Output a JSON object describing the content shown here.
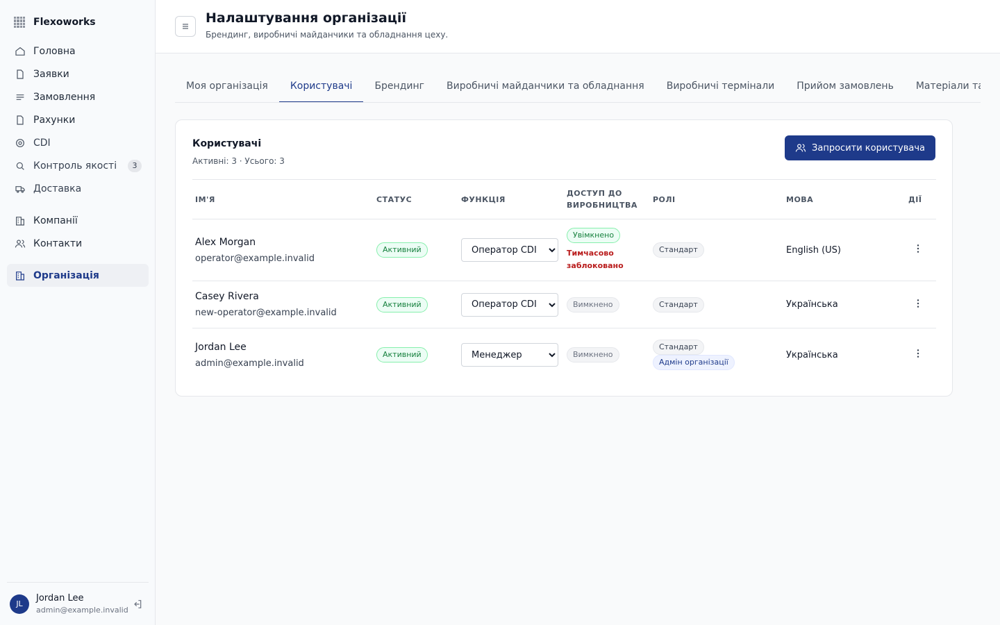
{
  "app": {
    "name": "Flexoworks"
  },
  "nav": [
    {
      "label": "Головна",
      "icon": "home-icon"
    },
    {
      "label": "Заявки",
      "icon": "file-icon"
    },
    {
      "label": "Замовлення",
      "icon": "list-icon"
    },
    {
      "label": "Рахунки",
      "icon": "file-icon"
    },
    {
      "label": "CDI",
      "icon": "target-icon"
    },
    {
      "label": "Контроль якості",
      "icon": "search-icon",
      "count": "3"
    },
    {
      "label": "Доставка",
      "icon": "truck-icon"
    },
    {
      "label": "Компанії",
      "icon": "building-icon"
    },
    {
      "label": "Контакти",
      "icon": "users-icon"
    },
    {
      "label": "Організація",
      "icon": "organization-icon",
      "active": true
    }
  ],
  "user": {
    "initials": "JL",
    "name": "Jordan Lee",
    "email": "admin@example.invalid"
  },
  "header": {
    "title": "Налаштування організації",
    "subtitle": "Брендинг, виробничі майданчики та обладнання цеху."
  },
  "tabs": [
    {
      "label": "Моя організація"
    },
    {
      "label": "Користувачі",
      "active": true
    },
    {
      "label": "Брендинг"
    },
    {
      "label": "Виробничі майданчики та обладнання"
    },
    {
      "label": "Виробничі термінали"
    },
    {
      "label": "Прийом замовлень"
    },
    {
      "label": "Матеріали та по"
    }
  ],
  "card": {
    "title": "Користувачі",
    "summary": "Активні: 3 · Усього: 3",
    "invite_label": "Запросити користувача"
  },
  "table": {
    "columns": {
      "name": "Ім'я",
      "status": "Статус",
      "function": "Функція",
      "access": "Доступ до виробництва",
      "roles": "Ролі",
      "language": "Мова",
      "actions": "Дії"
    },
    "rows": [
      {
        "name": "Alex Morgan",
        "email": "operator@example.invalid",
        "status": "Активний",
        "function": "Оператор CDI",
        "access": "Увімкнено",
        "access_note": "Тимчасово заблоковано",
        "roles": [
          "Стандарт"
        ],
        "language": "English (US)"
      },
      {
        "name": "Casey Rivera",
        "email": "new-operator@example.invalid",
        "status": "Активний",
        "function": "Оператор CDI",
        "access": "Вимкнено",
        "roles": [
          "Стандарт"
        ],
        "language": "Українська"
      },
      {
        "name": "Jordan Lee",
        "email": "admin@example.invalid",
        "status": "Активний",
        "function": "Менеджер",
        "access": "Вимкнено",
        "roles": [
          "Стандарт",
          "Адмін організації"
        ],
        "language": "Українська"
      }
    ],
    "function_options": [
      "Оператор CDI",
      "Менеджер"
    ]
  },
  "colors": {
    "primary": "#1e3a8a",
    "success": "#15803d",
    "danger": "#b91c1c"
  }
}
